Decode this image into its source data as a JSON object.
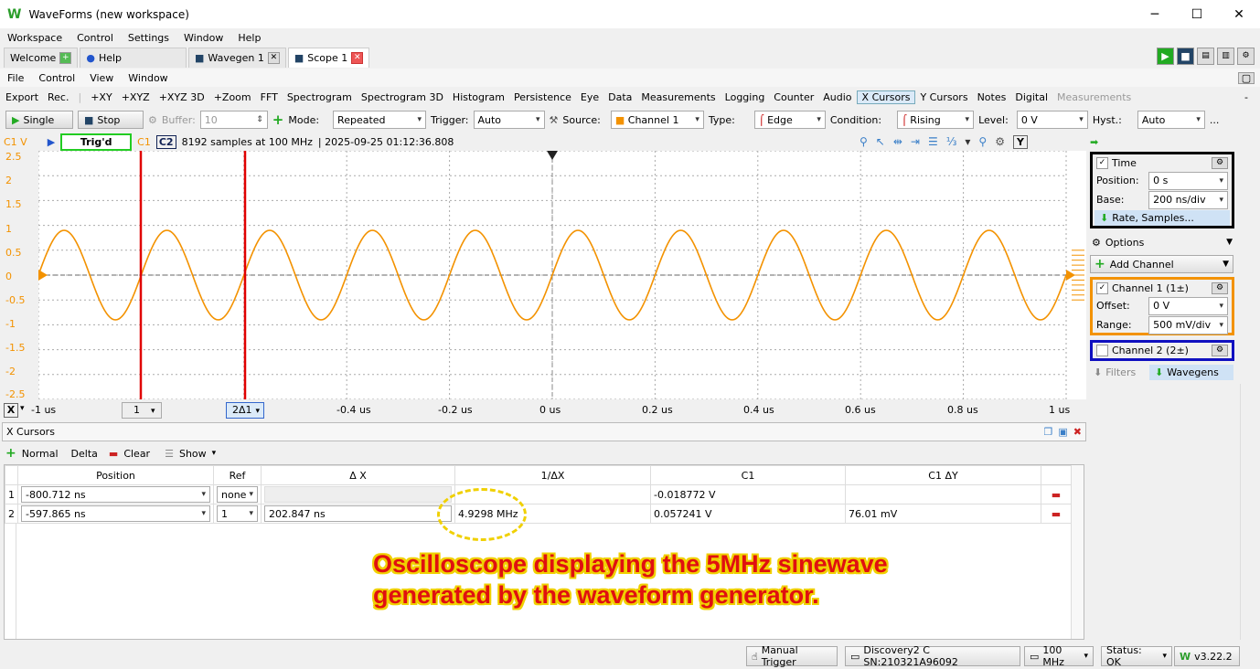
{
  "app": {
    "title": "WaveForms (new workspace)"
  },
  "main_menu": [
    "Workspace",
    "Control",
    "Settings",
    "Window",
    "Help"
  ],
  "tabs": [
    {
      "label": "Welcome"
    },
    {
      "label": "Help"
    },
    {
      "label": "Wavegen 1"
    },
    {
      "label": "Scope 1"
    }
  ],
  "scope_menu": [
    "File",
    "Control",
    "View",
    "Window"
  ],
  "scope_toolbar": [
    "Export",
    "Rec.",
    "+XY",
    "+XYZ",
    "+XYZ 3D",
    "+Zoom",
    "FFT",
    "Spectrogram",
    "Spectrogram 3D",
    "Histogram",
    "Persistence",
    "Eye",
    "Data",
    "Measurements",
    "Logging",
    "Counter",
    "Audio",
    "X Cursors",
    "Y Cursors",
    "Notes",
    "Digital",
    "Measurements"
  ],
  "scope_toolbar_end": "-",
  "controls": {
    "single": "Single",
    "stop": "Stop",
    "buffer_label": "Buffer:",
    "buffer_value": "10",
    "mode_label": "Mode:",
    "mode_value": "Repeated",
    "trigger_label": "Trigger:",
    "trigger_value": "Auto",
    "source_label": "Source:",
    "source_value": "Channel 1",
    "type_label": "Type:",
    "type_value": "Edge",
    "condition_label": "Condition:",
    "condition_value": "Rising",
    "level_label": "Level:",
    "level_value": "0 V",
    "hyst_label": "Hyst.:",
    "hyst_value": "Auto",
    "more": "..."
  },
  "info": {
    "c1v": "C1 V",
    "status": "Trig'd",
    "c1": "C1",
    "c2": "C2",
    "samples": "8192 samples at 100 MHz",
    "timestamp": "| 2025-09-25 01:12:36.808",
    "y_btn": "Y"
  },
  "y_ticks": [
    "2.5",
    "2",
    "1.5",
    "1",
    "0.5",
    "0",
    "-0.5",
    "-1",
    "-1.5",
    "-2",
    "-2.5"
  ],
  "x_axis": {
    "x_btn": "X",
    "cursor1": "1",
    "cursor2": "2Δ1",
    "ticks": [
      "-1 us",
      "-0.4 us",
      "-0.2 us",
      "0 us",
      "0.2 us",
      "0.4 us",
      "0.6 us",
      "0.8 us",
      "1 us"
    ]
  },
  "waveform": {
    "frequency_mhz": 5,
    "amplitude_v": 0.9,
    "time_range_us": [
      -1,
      1
    ],
    "cursor_times_ns": [
      -800.712,
      -597.865
    ],
    "trace_color": "#f39200",
    "cursor_color": "#e00000"
  },
  "right_panel": {
    "time": {
      "title": "Time",
      "position_label": "Position:",
      "position_value": "0 s",
      "base_label": "Base:",
      "base_value": "200 ns/div",
      "rate": "Rate, Samples..."
    },
    "options": "Options",
    "add_channel": "Add Channel",
    "ch1": {
      "title": "Channel 1 (1±)",
      "offset_label": "Offset:",
      "offset_value": "0 V",
      "range_label": "Range:",
      "range_value": "500 mV/div"
    },
    "ch2": {
      "title": "Channel 2 (2±)"
    },
    "filters": "Filters",
    "wavegens": "Wavegens"
  },
  "cursors": {
    "title": "X Cursors",
    "normal": "Normal",
    "delta": "Delta",
    "clear": "Clear",
    "show": "Show",
    "headers": [
      "",
      "Position",
      "Ref",
      "Δ X",
      "1/ΔX",
      "C1",
      "C1 ΔY"
    ],
    "rows": [
      {
        "idx": "1",
        "position": "-800.712 ns",
        "ref": "none",
        "dx": "",
        "inv": "",
        "c1": "-0.018772 V",
        "c1dy": ""
      },
      {
        "idx": "2",
        "position": "-597.865 ns",
        "ref": "1",
        "dx": "202.847 ns",
        "inv": "4.9298 MHz",
        "c1": "0.057241 V",
        "c1dy": "76.01 mV"
      }
    ]
  },
  "annotation": {
    "line1": "Oscilloscope displaying the 5MHz sinewave",
    "line2": "generated by the waveform generator."
  },
  "statusbar": {
    "manual_trigger": "Manual Trigger",
    "device": "Discovery2 C SN:210321A96092",
    "freq": "100 MHz",
    "status": "Status: OK",
    "version": "v3.22.2"
  }
}
